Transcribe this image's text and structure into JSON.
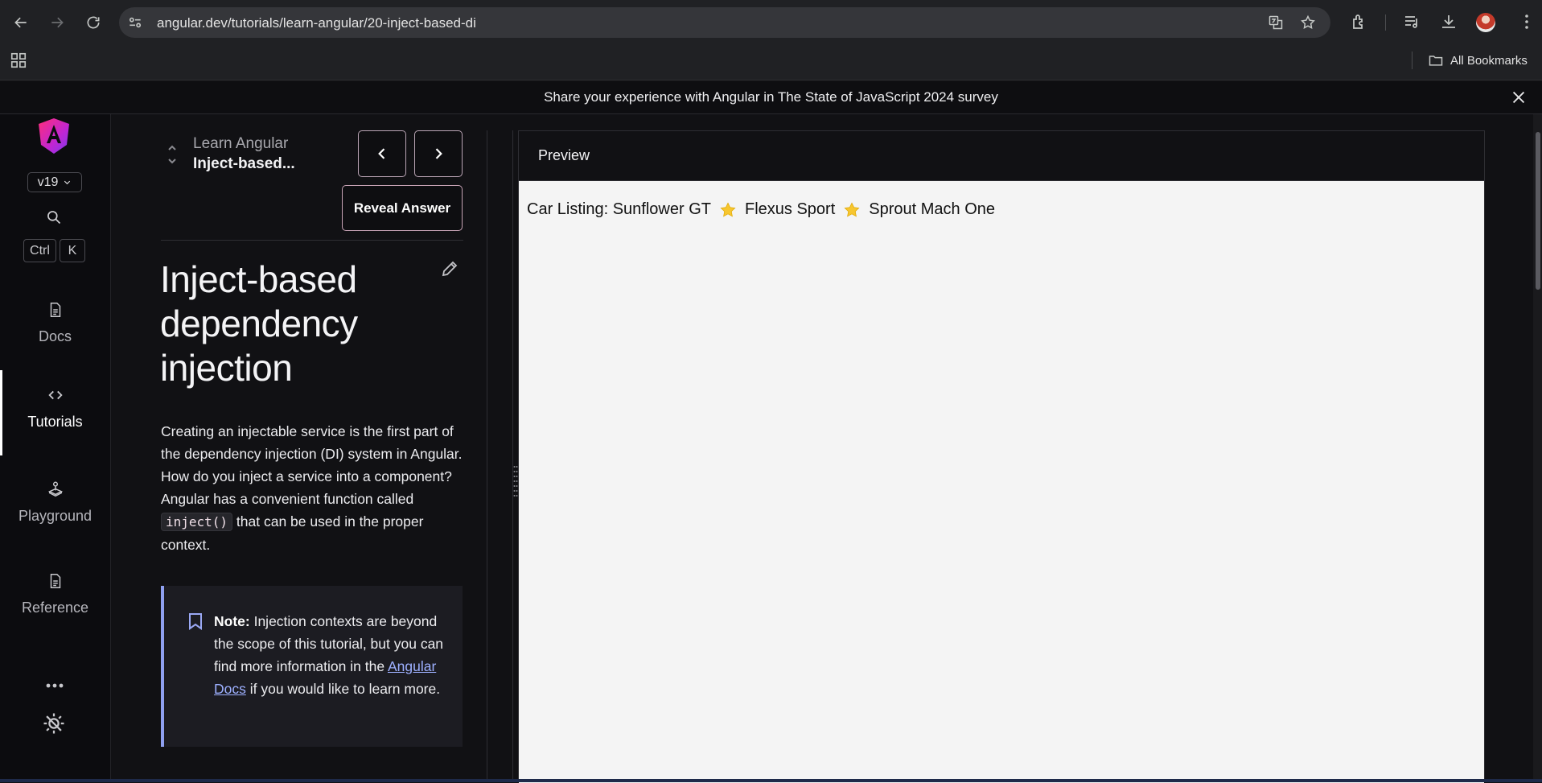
{
  "browser": {
    "url": "angular.dev/tutorials/learn-angular/20-inject-based-di",
    "bookmarks_label": "All Bookmarks"
  },
  "banner": {
    "text": "Share your experience with Angular in The State of JavaScript 2024 survey"
  },
  "sidenav": {
    "version": "v19",
    "shortcut_keys": [
      "Ctrl",
      "K"
    ],
    "items": [
      {
        "label": "Docs",
        "icon": "document-icon"
      },
      {
        "label": "Tutorials",
        "icon": "code-brackets-icon"
      },
      {
        "label": "Playground",
        "icon": "joystick-icon"
      },
      {
        "label": "Reference",
        "icon": "document-icon"
      }
    ],
    "active": "Tutorials"
  },
  "tutorial": {
    "breadcrumb_parent": "Learn Angular",
    "breadcrumb_current": "Inject-based...",
    "reveal_label": "Reveal Answer",
    "title": "Inject-based dependency injection",
    "para_before_code": "Creating an injectable service is the first part of the dependency injection (DI) system in Angular. How do you inject a service into a component? Angular has a convenient function called ",
    "code": "inject()",
    "para_after_code": " that can be used in the proper context.",
    "note_label": "Note:",
    "note_before_link": " Injection contexts are beyond the scope of this tutorial, but you can find more information in the ",
    "note_link": "Angular Docs",
    "note_after_link": " if you would like to learn more."
  },
  "preview": {
    "title": "Preview",
    "listing_prefix": "Car Listing:",
    "cars": [
      "Sunflower GT",
      "Flexus Sport",
      "Sprout Mach One"
    ]
  },
  "colors": {
    "accent_note": "#8fa0f0",
    "link": "#9db0ff",
    "star": "#f7c62f"
  }
}
